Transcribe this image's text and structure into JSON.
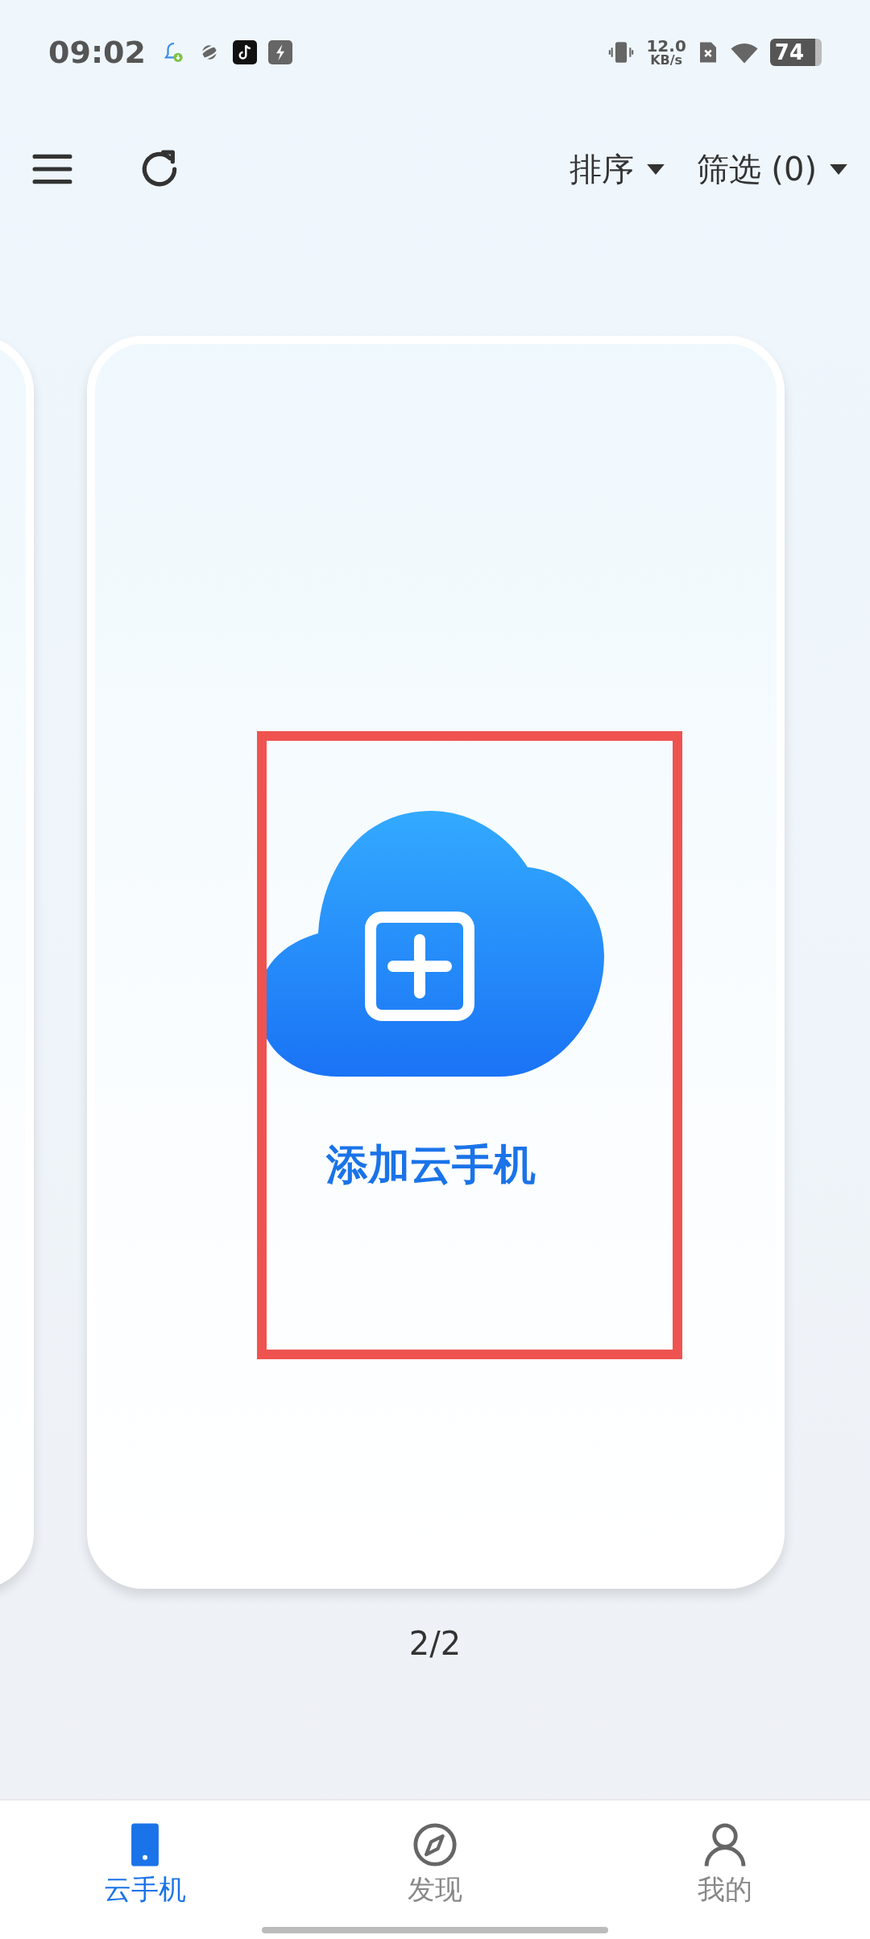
{
  "status_bar": {
    "time": "09:02",
    "speed_value": "12.0",
    "speed_unit": "KB/s",
    "battery": "74"
  },
  "toolbar": {
    "sort": "排序",
    "filter": "筛选 (0)"
  },
  "card": {
    "label": "添加云手机",
    "highlighted": true
  },
  "pager": "2/2",
  "nav": [
    {
      "kind": "phone",
      "label": "云手机",
      "selected": true
    },
    {
      "kind": "compass",
      "label": "发现",
      "selected": false
    },
    {
      "kind": "person",
      "label": "我的",
      "selected": false
    }
  ]
}
